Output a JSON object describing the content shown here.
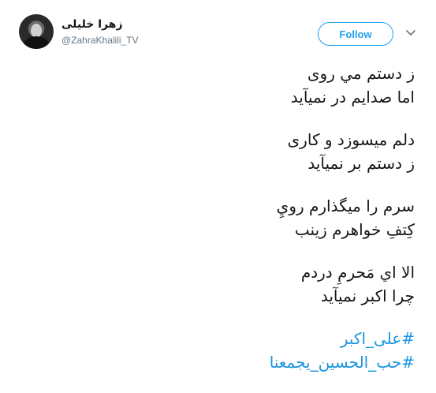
{
  "user": {
    "display_name": "زهرا خلیلی",
    "handle": "@ZahraKhalili_TV"
  },
  "actions": {
    "follow_label": "Follow",
    "caret_icon": "chevron-down-icon"
  },
  "tweet": {
    "stanzas": [
      [
        "ز دستم مي روی",
        "اما صدايم در نميآيد"
      ],
      [
        "دلم ميسوزد و کاری",
        "ز دستم بر نميآيد"
      ],
      [
        "سرم را ميگذارم رويِ",
        "کِتفِ خواهرم زينب"
      ],
      [
        "الا اي مَحرمِ دردم",
        "چرا اکبر نميآيد"
      ]
    ],
    "hashtags": [
      "#علی_اکبر",
      "#حب_الحسين_يجمعنا"
    ]
  },
  "colors": {
    "accent": "#1da1f2",
    "hashtag": "#1b95e0",
    "text": "#14171a",
    "muted": "#657786"
  }
}
